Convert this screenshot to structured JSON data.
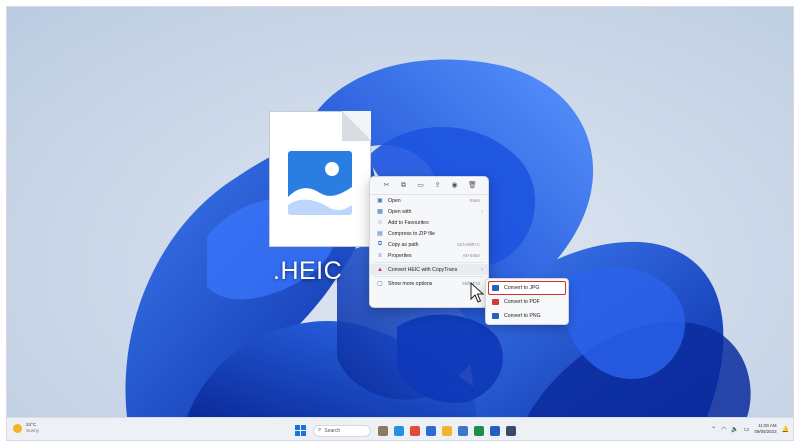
{
  "desktop": {
    "file": {
      "extension_label": ".HEIC",
      "icon": "image-file-icon"
    }
  },
  "context_menu": {
    "quick_actions": [
      {
        "icon": "cut-icon",
        "glyph": "✂"
      },
      {
        "icon": "copy-icon",
        "glyph": "⧉"
      },
      {
        "icon": "rename-icon",
        "glyph": "▭"
      },
      {
        "icon": "share-icon",
        "glyph": "⇪"
      },
      {
        "icon": "info-icon",
        "glyph": "◉"
      },
      {
        "icon": "delete-icon",
        "glyph": "🗑"
      }
    ],
    "items": [
      {
        "label": "Open",
        "shortcut": "Enter",
        "icon": "open-icon"
      },
      {
        "label": "Open with",
        "shortcut": "",
        "icon": "open-with-icon",
        "has_submenu": true
      },
      {
        "label": "Add to Favourites",
        "shortcut": "",
        "icon": "star-icon"
      },
      {
        "label": "Compress to ZIP file",
        "shortcut": "",
        "icon": "zip-icon"
      },
      {
        "label": "Copy as path",
        "shortcut": "Ctrl+Shift+C",
        "icon": "copy-path-icon"
      },
      {
        "label": "Properties",
        "shortcut": "Alt+Enter",
        "icon": "properties-icon"
      },
      {
        "label": "Convert HEIC with CopyTrans",
        "shortcut": "",
        "icon": "copytrans-icon",
        "has_submenu": true
      },
      {
        "label": "Show more options",
        "shortcut": "Shift+F10",
        "icon": "more-options-icon"
      }
    ]
  },
  "submenu": {
    "items": [
      {
        "label": "Convert to JPG",
        "icon": "jpg-icon",
        "color": "#2b5fbf",
        "selected": true
      },
      {
        "label": "Convert to PDF",
        "icon": "pdf-icon",
        "color": "#d63a3a",
        "selected": false
      },
      {
        "label": "Convert to PNG",
        "icon": "png-icon",
        "color": "#2b5fbf",
        "selected": false
      }
    ]
  },
  "taskbar": {
    "weather": {
      "temp": "24°C",
      "condition": "Sunny"
    },
    "search_placeholder": "Search",
    "apps": [
      "#8a7b60",
      "#2a8fe0",
      "#e24a3a",
      "#2d6ad4",
      "#f0b52b",
      "#3b77c6",
      "#1f8c4b",
      "#255fbf",
      "#3a4a6a"
    ],
    "clock": {
      "time": "11:00 AM",
      "date": "09/06/2023"
    }
  },
  "colors": {
    "accent": "#1a73d9",
    "highlight": "#d62f35"
  }
}
